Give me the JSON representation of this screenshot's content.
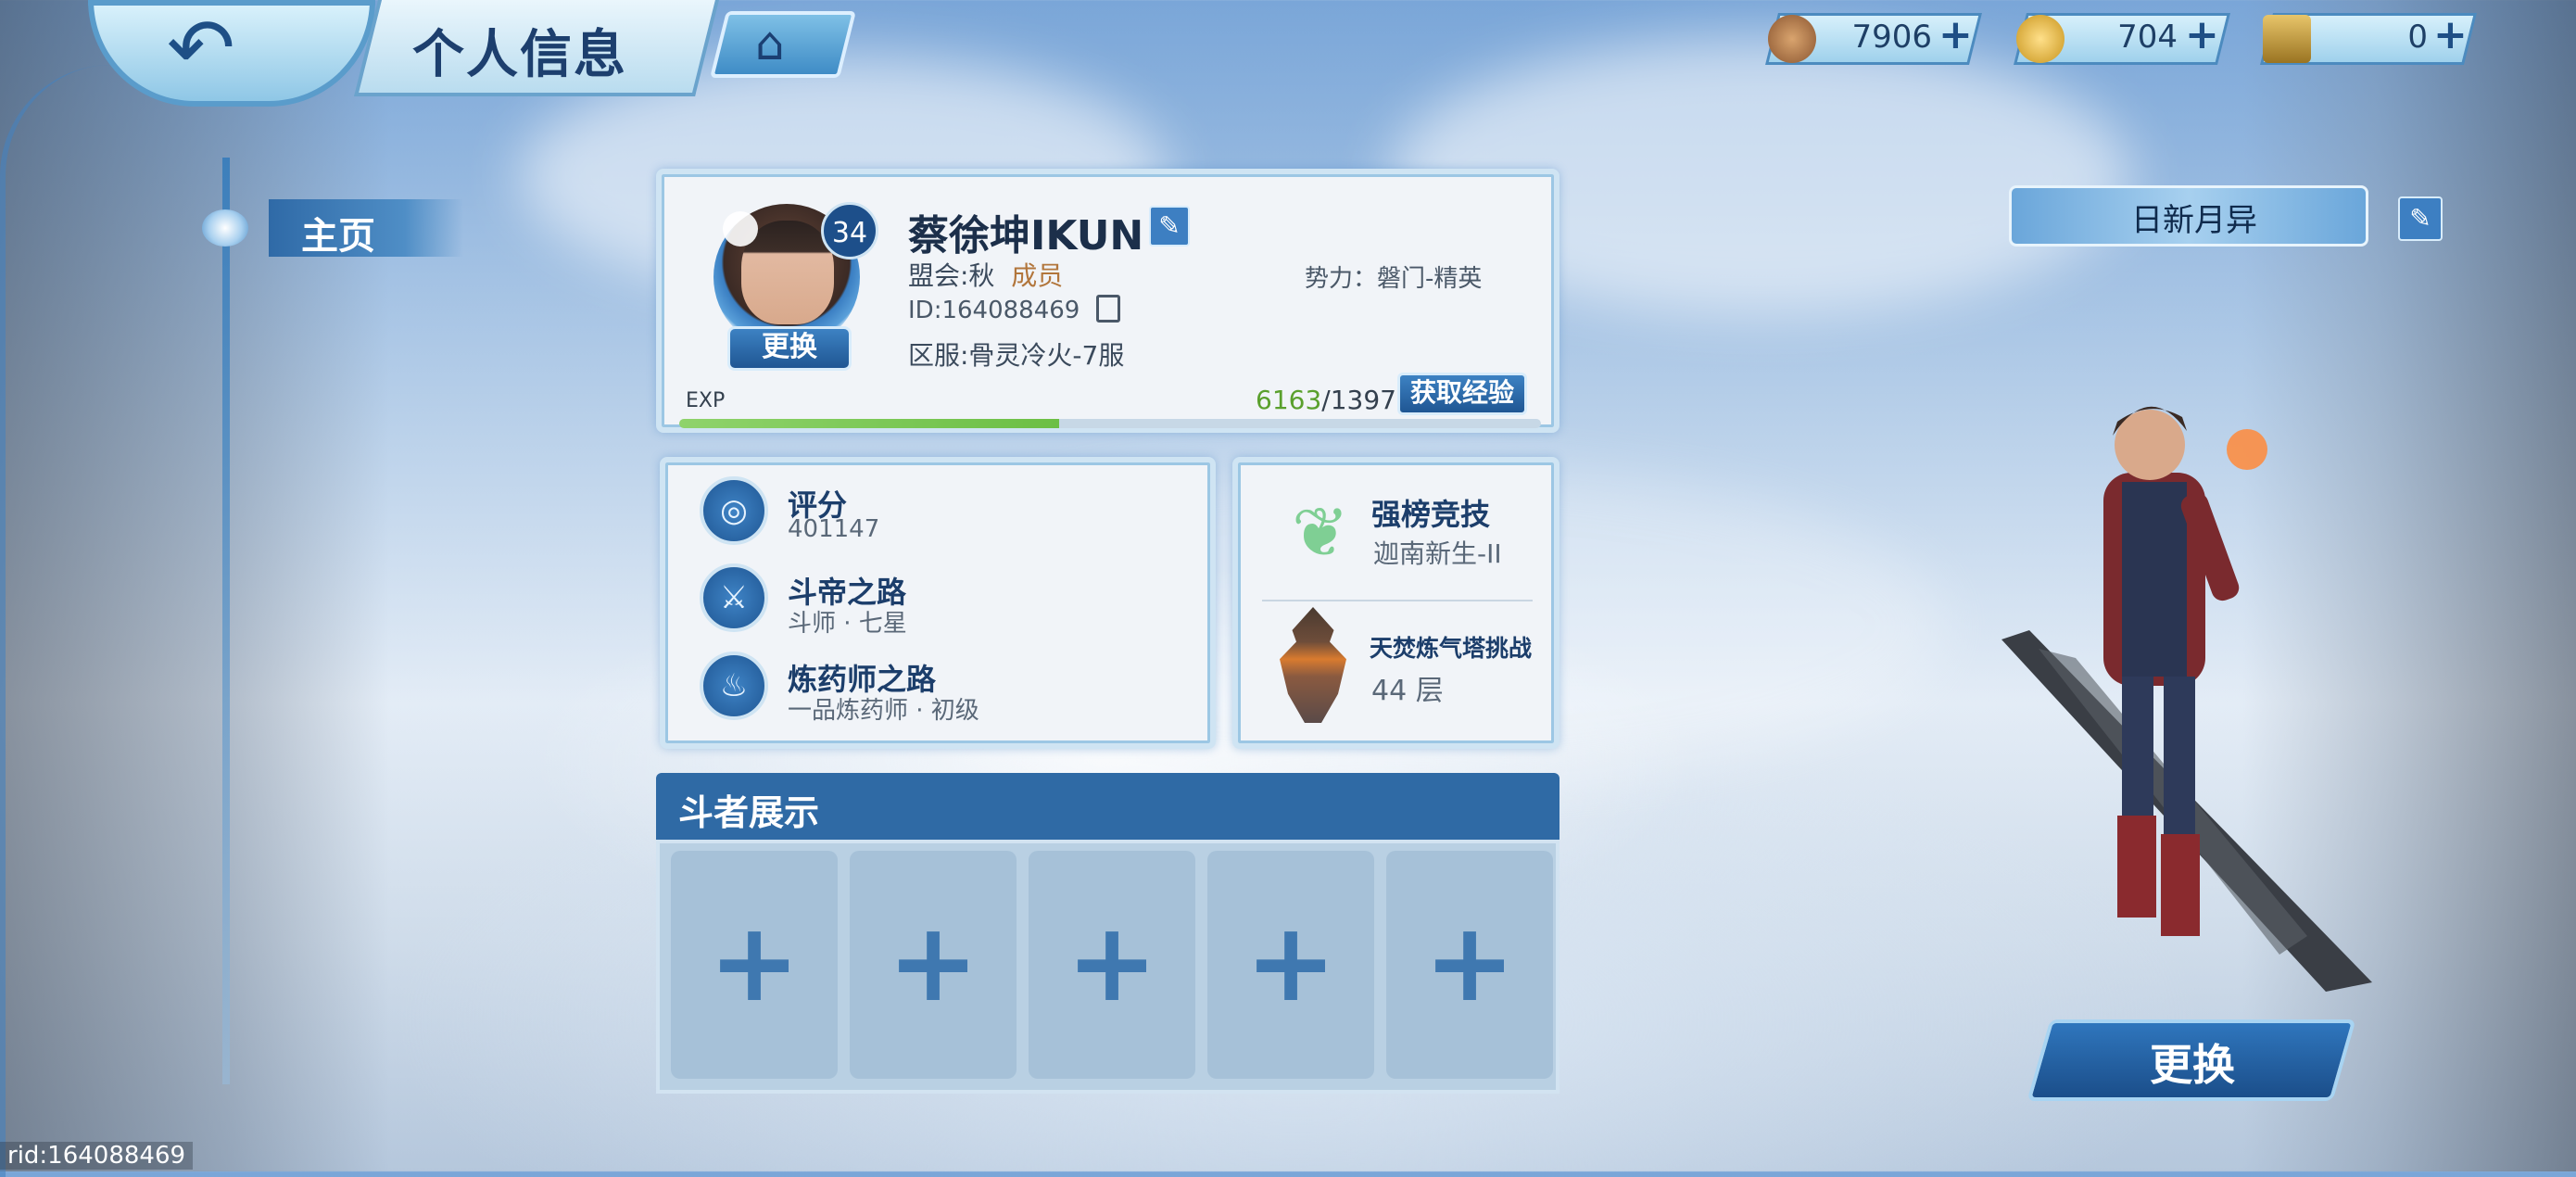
{
  "header": {
    "title": "个人信息"
  },
  "currencies": [
    {
      "icon": "copper-coin-icon",
      "value": "7906"
    },
    {
      "icon": "gold-ingot-icon",
      "value": "704"
    },
    {
      "icon": "ticket-icon",
      "value": "0"
    }
  ],
  "nav": {
    "home": "主页"
  },
  "profile": {
    "level": "34",
    "name": "蔡徐坤IKUN",
    "guild_label": "盟会:秋",
    "guild_role": "成员",
    "faction": "势力：磐门-精英",
    "id": "ID:164088469",
    "server": "区服:骨灵冷火-7服",
    "avatar_button": "更换",
    "exp_label": "EXP",
    "exp_current": "6163",
    "exp_sep": "/",
    "exp_max": "13976",
    "exp_progress": 0.441,
    "get_exp_button": "获取经验"
  },
  "stats": [
    {
      "icon": "score-icon",
      "title": "评分",
      "value": "401147"
    },
    {
      "icon": "fighter-path-icon",
      "title": "斗帝之路",
      "value": "斗师 · 七星"
    },
    {
      "icon": "alchemist-icon",
      "title": "炼药师之路",
      "value": "一品炼药师 · 初级"
    }
  ],
  "arena": {
    "title": "强榜竞技",
    "rank": "迦南新生-II"
  },
  "tower": {
    "title": "天焚炼气塔挑战",
    "floor": "44 层"
  },
  "showcase": {
    "title": "斗者展示",
    "slots": [
      "+",
      "+",
      "+",
      "+",
      "+"
    ]
  },
  "character": {
    "title_badge": "日新月异",
    "change_button": "更换"
  },
  "footer": {
    "rid": "rid:164088469"
  }
}
